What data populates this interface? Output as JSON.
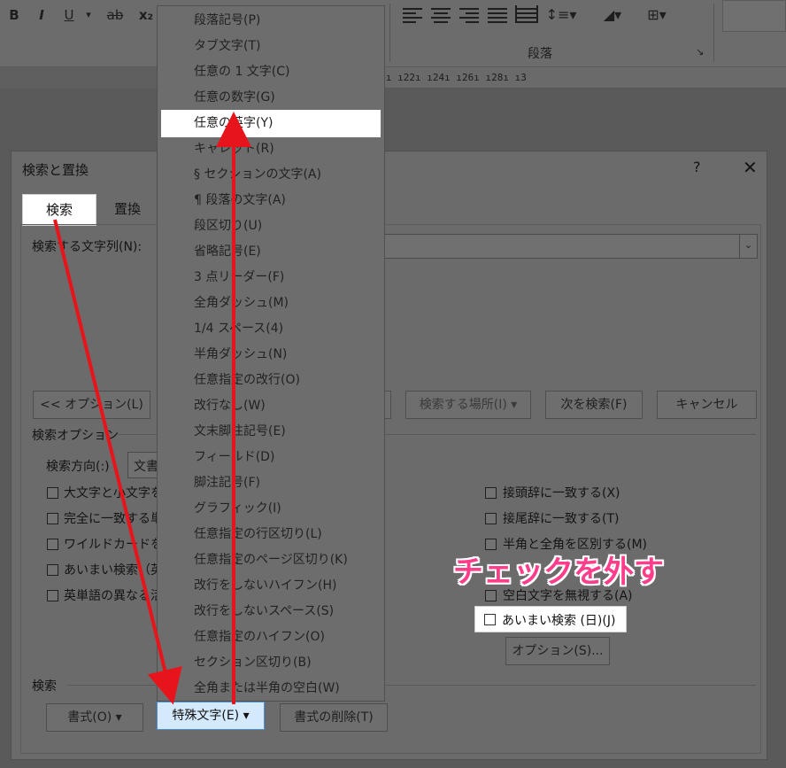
{
  "ribbon": {
    "bold": "B",
    "italic": "I",
    "underline": "U",
    "strike": "ab",
    "subscript": "x₂",
    "paragraph_group": "段落",
    "ruler": "ı8ı ı10ı ı12ı ı14ı ı16ı ı18ı ı20ı ı22ı ı24ı ı26ı ı28ı ı3"
  },
  "dialog": {
    "title": "検索と置換",
    "help": "?",
    "close": "✕",
    "tabs": {
      "search": "検索",
      "replace": "置換"
    },
    "find_label": "検索する文字列(N):",
    "options_button": "<< オプション(L)",
    "find_in_button": "検索する場所(I) ▾",
    "find_next_button": "次を検索(F)",
    "cancel_button": "キャンセル",
    "search_options_header": "検索オプション",
    "direction_label": "検索方向(:)",
    "direction_value": "文書",
    "left_checks": [
      "大文字と小文字を",
      "完全に一致する単",
      "ワイルドカードを使",
      "あいまい検索（英",
      "英単語の異なる活"
    ],
    "right_checks": [
      "接頭辞に一致する(X)",
      "接尾辞に一致する(T)",
      "半角と全角を区別する(M)",
      "空白文字を無視する(A)"
    ],
    "fuzzy_ja": "あいまい検索 (日)(J)",
    "fuzzy_options_button": "オプション(S)...",
    "bottom_header": "検索",
    "format_button": "書式(O) ▾",
    "special_button": "特殊文字(E) ▾",
    "clear_format_button": "書式の削除(T)"
  },
  "menu": {
    "items": [
      "段落記号(P)",
      "タブ文字(T)",
      "任意の 1 文字(C)",
      "任意の数字(G)",
      "任意の英字(Y)",
      "キャレット(R)",
      "§ セクションの文字(A)",
      "¶ 段落の文字(A)",
      "段区切り(U)",
      "省略記号(E)",
      "3 点リーダー(F)",
      "全角ダッシュ(M)",
      "1/4 スペース(4)",
      "半角ダッシュ(N)",
      "任意指定の改行(O)",
      "改行なし(W)",
      "文末脚注記号(E)",
      "フィールド(D)",
      "脚注記号(F)",
      "グラフィック(I)",
      "任意指定の行区切り(L)",
      "任意指定のページ区切り(K)",
      "改行をしないハイフン(H)",
      "改行をしないスペース(S)",
      "任意指定のハイフン(O)",
      "セクション区切り(B)",
      "全角または半角の空白(W)"
    ],
    "selected": "任意の英字(Y)"
  },
  "annotation": {
    "text": "チェックを外す",
    "color": "#ff3d8b",
    "arrow_color": "#e8141b"
  }
}
